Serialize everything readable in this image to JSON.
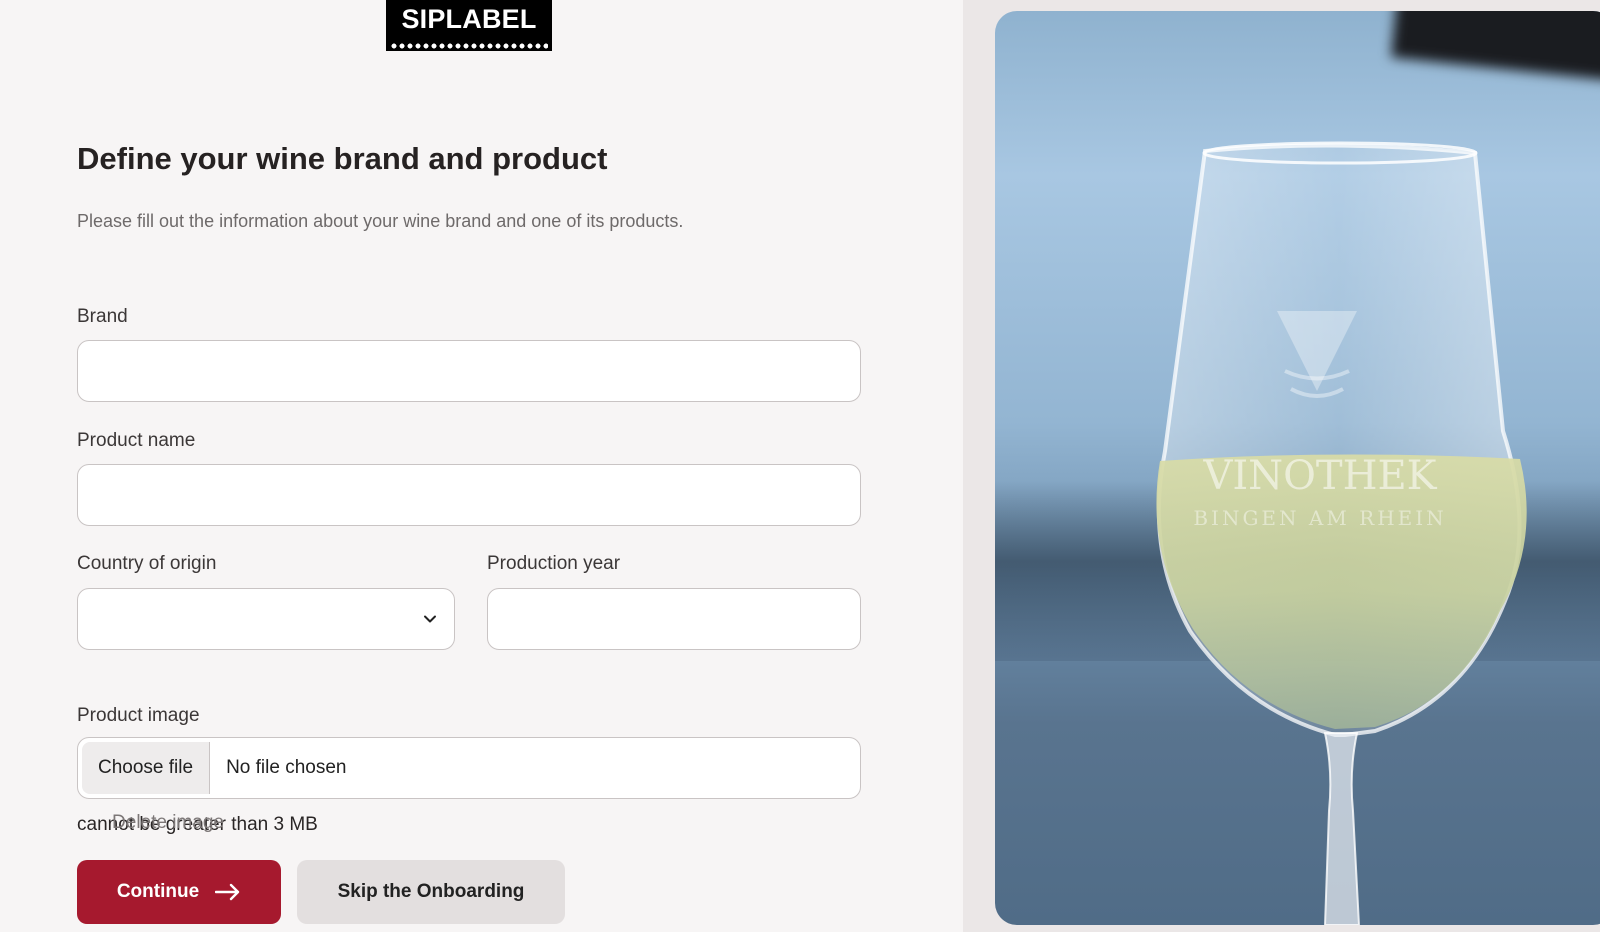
{
  "brand": {
    "logo_text": "SIPLABEL"
  },
  "page": {
    "title": "Define your wine brand and product",
    "subtitle": "Please fill out the information about your wine brand and one of its products."
  },
  "form": {
    "brand_label": "Brand",
    "brand_value": "",
    "product_name_label": "Product name",
    "product_name_value": "",
    "country_label": "Country of origin",
    "country_value": "",
    "year_label": "Production year",
    "year_value": "",
    "image_label": "Product image",
    "choose_file_label": "Choose file",
    "file_status": "No file chosen",
    "size_hint": "cannot be greater than 3 MB",
    "delete_image_label": "Delete image"
  },
  "actions": {
    "continue_label": "Continue",
    "skip_label": "Skip the Onboarding"
  },
  "photo": {
    "glass_text_main": "VINOTHEK",
    "glass_text_sub": "BINGEN AM RHEIN"
  },
  "colors": {
    "primary": "#a6192e",
    "secondary_button": "#e3dfdf",
    "panel_bg": "#f7f5f5",
    "page_bg": "#ebe7e7"
  }
}
